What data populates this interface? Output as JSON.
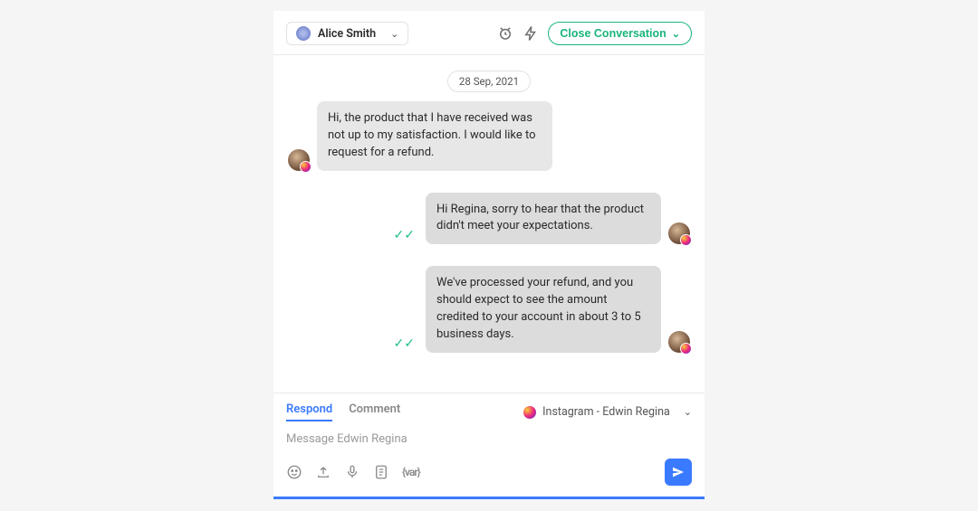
{
  "header": {
    "agent_name": "Alice Smith",
    "close_label": "Close Conversation"
  },
  "chat": {
    "date": "28 Sep, 2021",
    "messages": [
      {
        "side": "left",
        "text": "Hi, the product that I have received was not up to my satisfaction. I would like to request for a refund."
      },
      {
        "side": "right",
        "text": "Hi Regina, sorry to hear that the product didn't meet your expectations."
      },
      {
        "side": "right",
        "text": "We've processed your refund, and you should expect to see the amount credited to your account in about 3 to 5 business days."
      }
    ]
  },
  "composer": {
    "tabs": {
      "respond": "Respond",
      "comment": "Comment"
    },
    "active_tab": "respond",
    "channel_label": "Instagram - Edwin Regina",
    "placeholder": "Message Edwin Regina",
    "var_label": "{var}"
  }
}
